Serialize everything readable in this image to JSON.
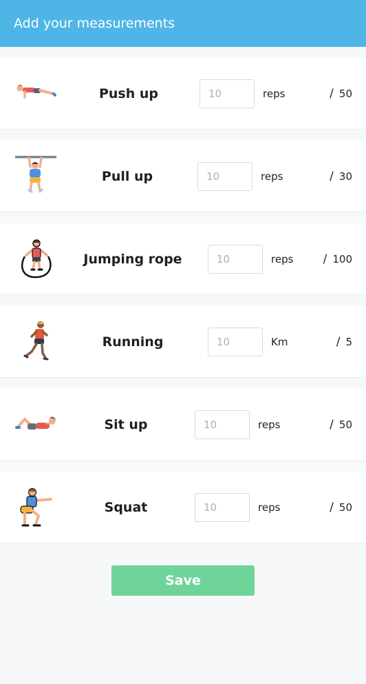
{
  "header": {
    "title": "Add your measurements"
  },
  "exercises": [
    {
      "name": "Push up",
      "value": "",
      "placeholder": "10",
      "unit": "reps",
      "max": "50",
      "icon": "push-up-icon"
    },
    {
      "name": "Pull up",
      "value": "",
      "placeholder": "10",
      "unit": "reps",
      "max": "30",
      "icon": "pull-up-icon"
    },
    {
      "name": "Jumping rope",
      "value": "",
      "placeholder": "10",
      "unit": "reps",
      "max": "100",
      "icon": "jumping-rope-icon"
    },
    {
      "name": "Running",
      "value": "",
      "placeholder": "10",
      "unit": "Km",
      "max": "5",
      "icon": "running-icon"
    },
    {
      "name": "Sit up",
      "value": "",
      "placeholder": "10",
      "unit": "reps",
      "max": "50",
      "icon": "sit-up-icon"
    },
    {
      "name": "Squat",
      "value": "",
      "placeholder": "10",
      "unit": "reps",
      "max": "50",
      "icon": "squat-icon"
    }
  ],
  "separator": "/",
  "save_label": "Save",
  "colors": {
    "header": "#4fb5e6",
    "save": "#6fd49a"
  }
}
